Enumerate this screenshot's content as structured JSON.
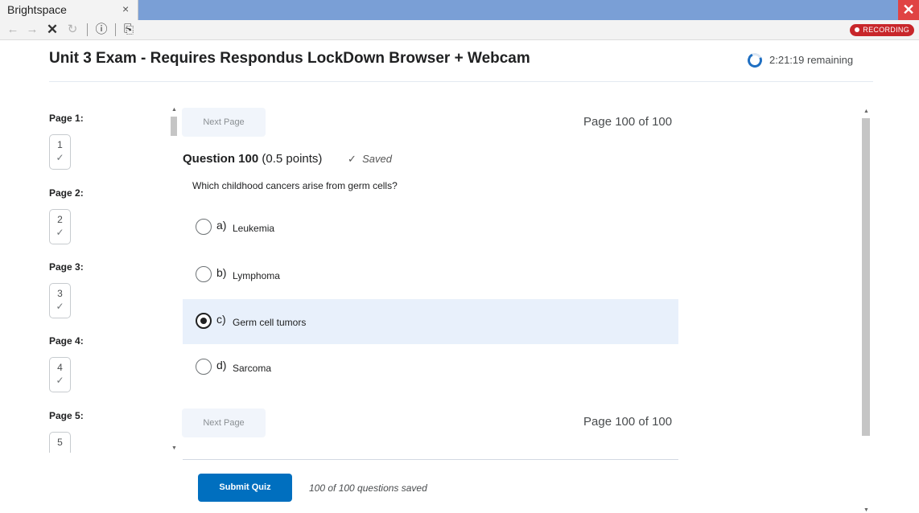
{
  "browser": {
    "tab_title": "Brightspace",
    "tab_close_icon": "×",
    "window_close_icon": "✕",
    "nav_icons": {
      "back": "←",
      "forward": "→",
      "stop": "✕",
      "reload": "↻",
      "info": "ⓘ",
      "page": "⎘"
    },
    "recording_label": "RECORDING"
  },
  "header": {
    "title": "Unit 3 Exam - Requires Respondus LockDown Browser + Webcam",
    "time_remaining": "2:21:19 remaining"
  },
  "page_nav": [
    {
      "label": "Page 1:",
      "number": "1",
      "check": "✓"
    },
    {
      "label": "Page 2:",
      "number": "2",
      "check": "✓"
    },
    {
      "label": "Page 3:",
      "number": "3",
      "check": "✓"
    },
    {
      "label": "Page 4:",
      "number": "4",
      "check": "✓"
    },
    {
      "label": "Page 5:",
      "number": "5",
      "check": ""
    }
  ],
  "quiz": {
    "next_page_label": "Next Page",
    "page_indicator": "Page 100 of 100",
    "question": {
      "title": "Question 100",
      "points": "(0.5 points)",
      "saved_icon": "✓",
      "saved_label": "Saved",
      "text": "Which childhood cancers arise from germ cells?",
      "options": [
        {
          "letter": "a)",
          "text": "Leukemia",
          "selected": false
        },
        {
          "letter": "b)",
          "text": "Lymphoma",
          "selected": false
        },
        {
          "letter": "c)",
          "text": "Germ cell tumors",
          "selected": true
        },
        {
          "letter": "d)",
          "text": "Sarcoma",
          "selected": false
        }
      ]
    },
    "submit_label": "Submit Quiz",
    "saved_count": "100 of 100 questions saved"
  },
  "colors": {
    "accent": "#006fbf",
    "tabbar": "#7a9fd6",
    "recording": "#c8262a",
    "selected_option_bg": "#e8f0fb"
  }
}
